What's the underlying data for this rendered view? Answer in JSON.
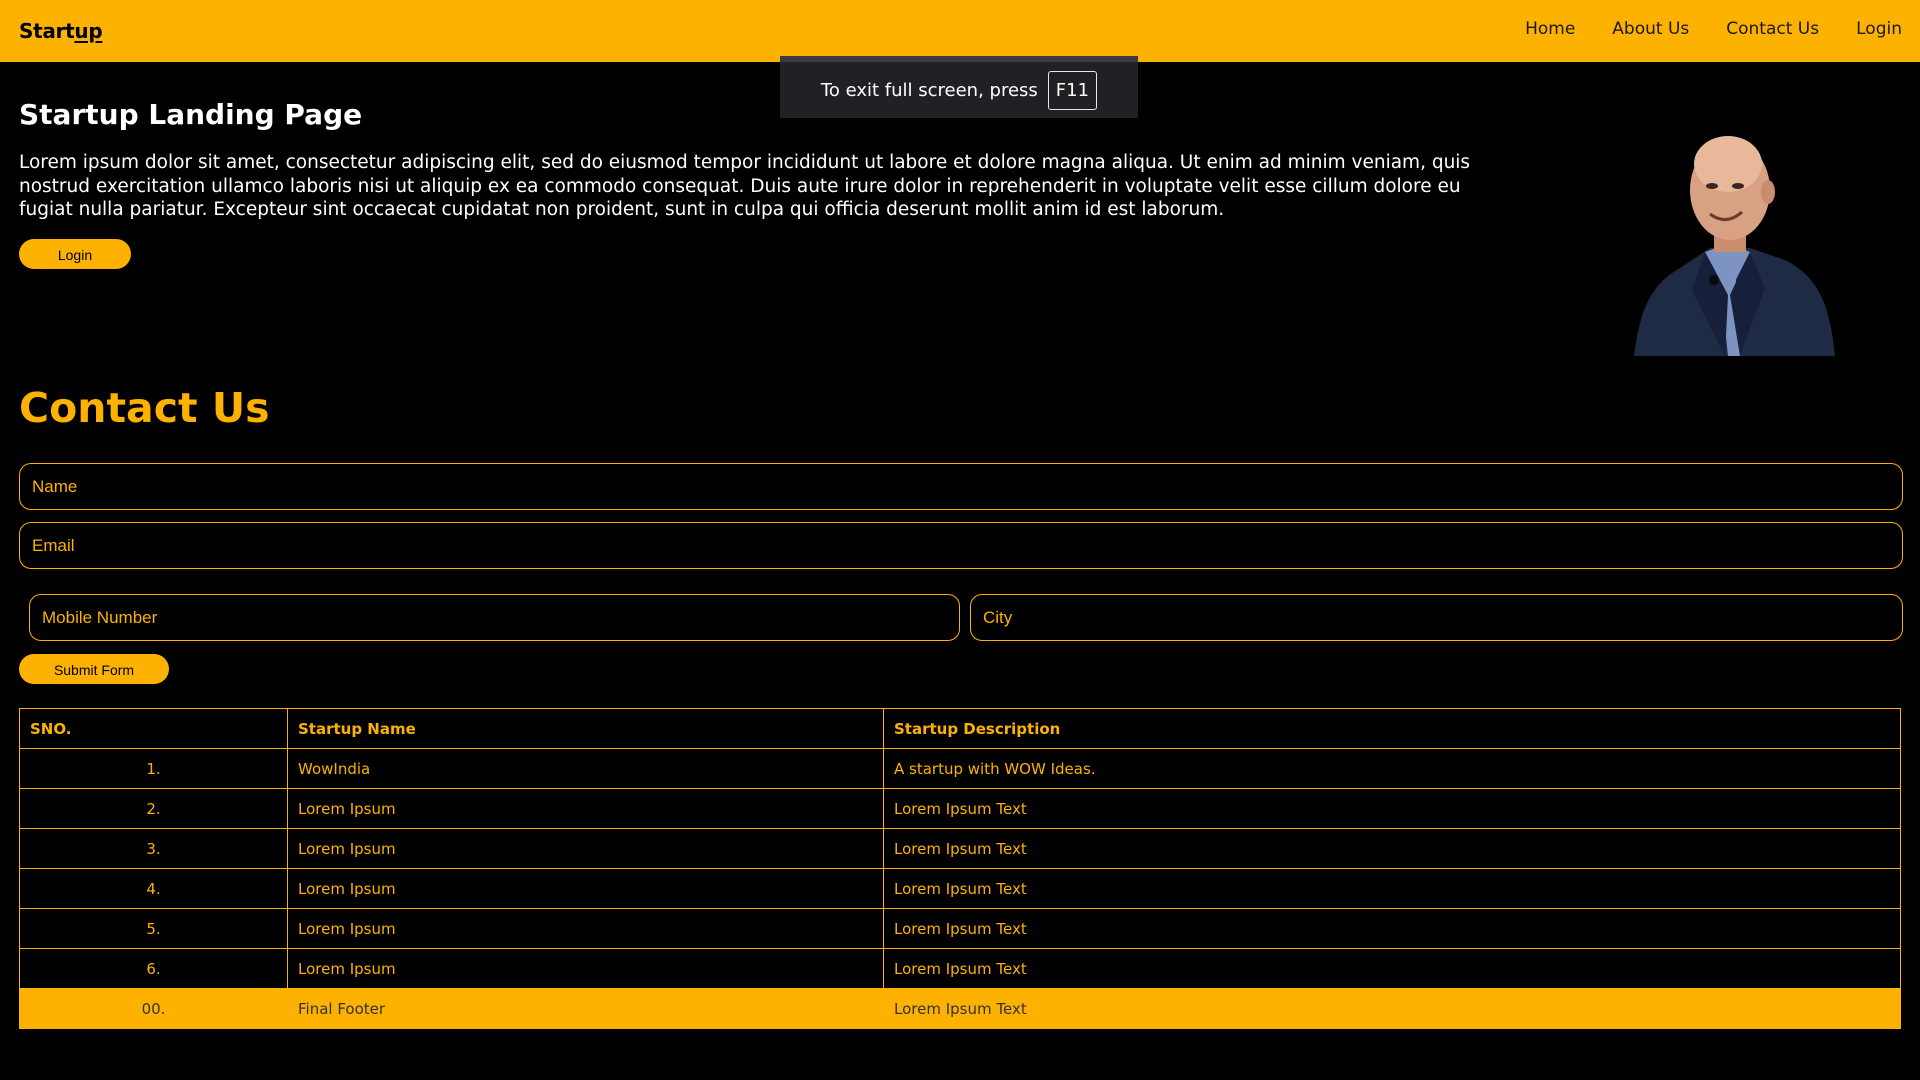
{
  "navbar": {
    "brand_main": "Start",
    "brand_underlined": "up",
    "links": [
      "Home",
      "About Us",
      "Contact Us",
      "Login"
    ]
  },
  "fullscreen_notice": {
    "text": "To exit full screen, press",
    "key": "F11"
  },
  "hero": {
    "title": "Startup Landing Page",
    "text": "Lorem ipsum dolor sit amet, consectetur adipiscing elit, sed do eiusmod tempor incididunt ut labore et dolore magna aliqua. Ut enim ad minim veniam, quis nostrud exercitation ullamco laboris nisi ut aliquip ex ea commodo consequat. Duis aute irure dolor in reprehenderit in voluptate velit esse cillum dolore eu fugiat nulla pariatur. Excepteur sint occaecat cupidatat non proident, sunt in culpa qui officia deserunt mollit anim id est laborum.",
    "login_button": "Login"
  },
  "contact": {
    "title": "Contact Us",
    "name_placeholder": "Name",
    "email_placeholder": "Email",
    "mobile_placeholder": "Mobile Number",
    "city_placeholder": "City",
    "submit_button": "Submit Form"
  },
  "table": {
    "headers": [
      "SNO.",
      "Startup Name",
      "Startup Description"
    ],
    "rows": [
      {
        "sno": "1.",
        "name": "WowIndia",
        "desc": "A startup with WOW Ideas."
      },
      {
        "sno": "2.",
        "name": "Lorem Ipsum",
        "desc": "Lorem Ipsum Text"
      },
      {
        "sno": "3.",
        "name": "Lorem Ipsum",
        "desc": "Lorem Ipsum Text"
      },
      {
        "sno": "4.",
        "name": "Lorem Ipsum",
        "desc": "Lorem Ipsum Text"
      },
      {
        "sno": "5.",
        "name": "Lorem Ipsum",
        "desc": "Lorem Ipsum Text"
      },
      {
        "sno": "6.",
        "name": "Lorem Ipsum",
        "desc": "Lorem Ipsum Text"
      }
    ],
    "footer": {
      "sno": "00.",
      "name": "Final Footer",
      "desc": "Lorem Ipsum Text"
    }
  },
  "colors": {
    "accent": "#fdb101",
    "background": "#000000",
    "text": "#ffffff"
  }
}
